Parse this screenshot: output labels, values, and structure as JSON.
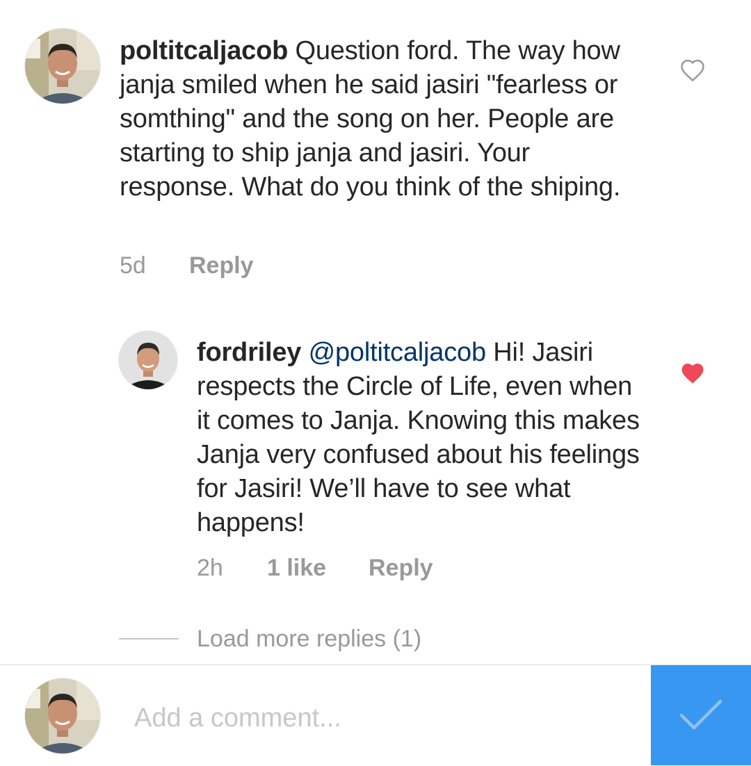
{
  "colors": {
    "text": "#262626",
    "secondary": "#999999",
    "mention": "#003569",
    "liked_heart": "#ed4956",
    "post_button_bg": "#3897f0"
  },
  "comments": [
    {
      "username": "poltitcaljacob",
      "text": " Question ford. The way how janja smiled when he said jasiri \"fearless or somthing\" and the song on her. People are starting to ship janja and jasiri. Your response. What do you think of the shiping.",
      "time": "5d",
      "reply_label": "Reply",
      "liked": false,
      "like_icon": "heart-outline-icon"
    },
    {
      "username": "fordriley",
      "mention": "@poltitcaljacob",
      "text": " Hi! Jasiri respects the Circle of Life, even when it comes to Janja. Knowing this makes Janja very confused about his feelings for Jasiri! We’ll have to see what happens!",
      "time": "2h",
      "likes_label": "1 like",
      "reply_label": "Reply",
      "liked": true,
      "like_icon": "heart-filled-icon"
    }
  ],
  "load_more_replies": "Load more replies (1)",
  "composer": {
    "placeholder": "Add a comment...",
    "post_icon": "checkmark-icon"
  }
}
